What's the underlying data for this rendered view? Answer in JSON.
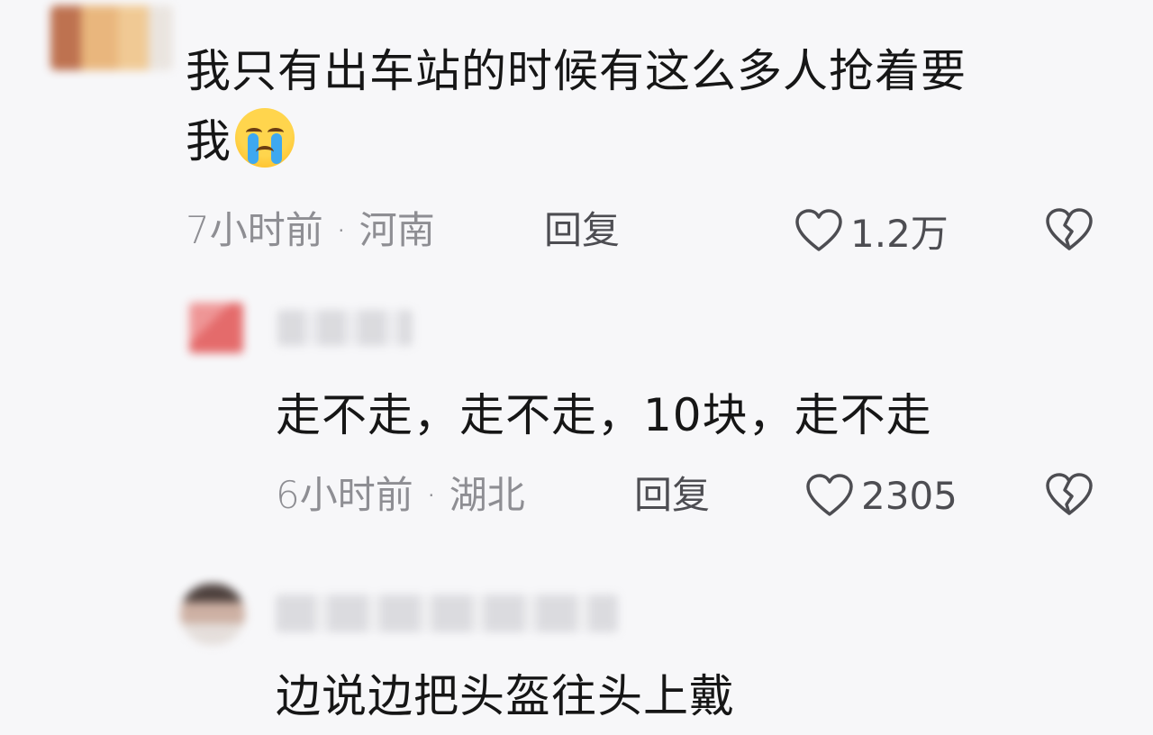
{
  "comments": [
    {
      "text_line1": "我只有出车站的时候有这么多人抢着要",
      "text_line2": "我",
      "emoji": "loudly-crying-face",
      "time": "7小时前",
      "separator": " · ",
      "location": "河南",
      "reply_label": "回复",
      "likes": "1.2万"
    },
    {
      "text": "走不走，走不走，10块，走不走",
      "time": "6小时前",
      "separator": " · ",
      "location": "湖北",
      "reply_label": "回复",
      "likes": "2305"
    },
    {
      "text": "边说边把头盔往头上戴"
    }
  ],
  "icons": {
    "like": "heart-outline-icon",
    "dislike": "broken-heart-icon"
  },
  "colors": {
    "background": "#f7f7f9",
    "text": "#161616",
    "meta": "#8e8e93",
    "action": "#4d4d52"
  }
}
